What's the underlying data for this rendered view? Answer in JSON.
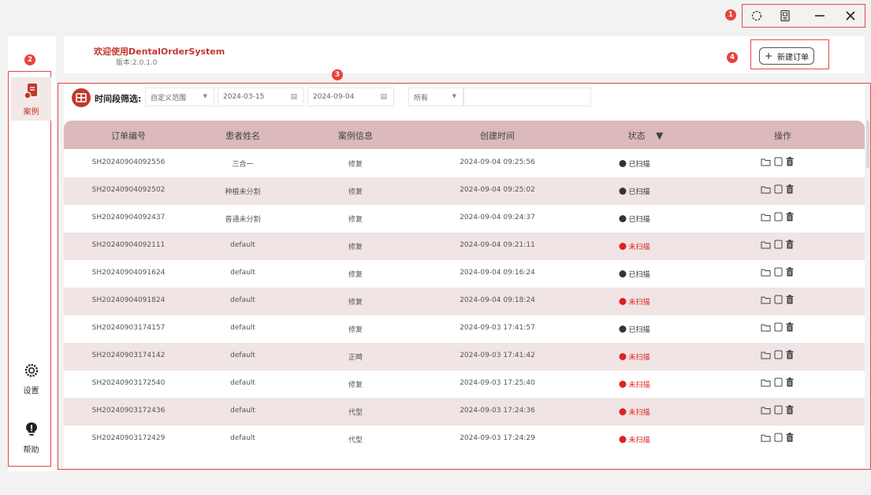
{
  "annotations": [
    "1",
    "2",
    "3",
    "4"
  ],
  "window_controls": {
    "icons": [
      "target-icon",
      "scan-icon",
      "minimize-icon",
      "close-icon"
    ]
  },
  "sidebar": {
    "items": [
      {
        "label": "案例",
        "icon": "case-icon",
        "active": true
      },
      {
        "label": "设置",
        "icon": "gear-icon",
        "active": false
      },
      {
        "label": "帮助",
        "icon": "help-icon",
        "active": false
      }
    ]
  },
  "header": {
    "welcome": "欢迎使用DentalOrderSystem",
    "version": "版本:2.0.1.0",
    "new_order_label": "新建订单"
  },
  "filter": {
    "label": "时间段筛选:",
    "range_select": "自定义范围",
    "start_date": "2024-03-15",
    "end_date": "2024-09-04",
    "status_select": "所有",
    "search_value": ""
  },
  "table": {
    "columns": [
      "订单编号",
      "患者姓名",
      "案例信息",
      "创建时间",
      "状态",
      "操作"
    ],
    "rows": [
      {
        "order_id": "SH20240904092556",
        "patient": "三合一",
        "case": "修复",
        "created": "2024-09-04 09:25:56",
        "status": "已扫描",
        "scanned": true
      },
      {
        "order_id": "SH20240904092502",
        "patient": "种植未分割",
        "case": "修复",
        "created": "2024-09-04 09:25:02",
        "status": "已扫描",
        "scanned": true
      },
      {
        "order_id": "SH20240904092437",
        "patient": "普通未分割",
        "case": "修复",
        "created": "2024-09-04 09:24:37",
        "status": "已扫描",
        "scanned": true
      },
      {
        "order_id": "SH20240904092111",
        "patient": "default",
        "case": "修复",
        "created": "2024-09-04 09:21:11",
        "status": "未扫描",
        "scanned": false
      },
      {
        "order_id": "SH20240904091624",
        "patient": "default",
        "case": "修复",
        "created": "2024-09-04 09:16:24",
        "status": "已扫描",
        "scanned": true
      },
      {
        "order_id": "SH20240904091824",
        "patient": "default",
        "case": "修复",
        "created": "2024-09-04 09:18:24",
        "status": "未扫描",
        "scanned": false
      },
      {
        "order_id": "SH20240903174157",
        "patient": "default",
        "case": "修复",
        "created": "2024-09-03 17:41:57",
        "status": "已扫描",
        "scanned": true
      },
      {
        "order_id": "SH20240903174142",
        "patient": "default",
        "case": "正畸",
        "created": "2024-09-03 17:41:42",
        "status": "未扫描",
        "scanned": false
      },
      {
        "order_id": "SH20240903172540",
        "patient": "default",
        "case": "修复",
        "created": "2024-09-03 17:25:40",
        "status": "未扫描",
        "scanned": false
      },
      {
        "order_id": "SH20240903172436",
        "patient": "default",
        "case": "代型",
        "created": "2024-09-03 17:24:36",
        "status": "未扫描",
        "scanned": false
      },
      {
        "order_id": "SH20240903172429",
        "patient": "default",
        "case": "代型",
        "created": "2024-09-03 17:24:29",
        "status": "未扫描",
        "scanned": false
      }
    ]
  },
  "colors": {
    "accent": "#c0392b",
    "annotation": "#e54848",
    "header_row": "#dcb9bc",
    "alt_row": "#f0e4e4",
    "scanned": "#333333",
    "unscanned": "#e02020"
  }
}
